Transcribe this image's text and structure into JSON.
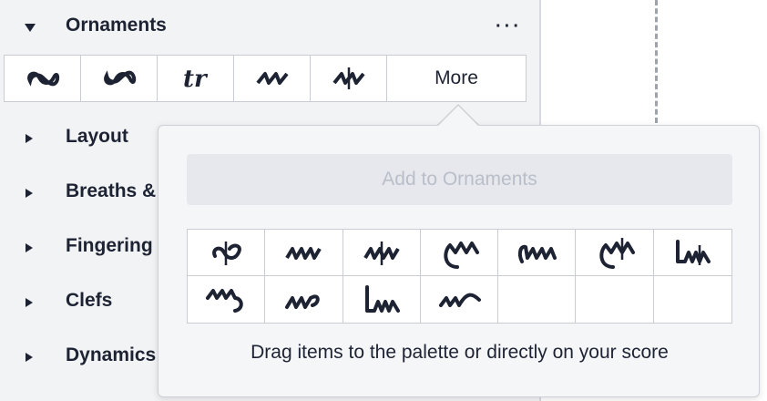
{
  "panel": {
    "sections": [
      {
        "title": "Ornaments",
        "expanded": true
      },
      {
        "title": "Layout",
        "expanded": false
      },
      {
        "title": "Breaths &",
        "expanded": false
      },
      {
        "title": "Fingering",
        "expanded": false
      },
      {
        "title": "Clefs",
        "expanded": false
      },
      {
        "title": "Dynamics",
        "expanded": false
      }
    ],
    "menu_icon": "more-options-icon",
    "ornament_palette": {
      "items": [
        {
          "icon": "turn-icon"
        },
        {
          "icon": "inverted-turn-icon"
        },
        {
          "icon": "trill-icon"
        },
        {
          "icon": "short-trill-icon"
        },
        {
          "icon": "mordent-icon"
        }
      ],
      "more_label": "More"
    }
  },
  "popup": {
    "add_button_label": "Add to Ornaments",
    "hint": "Drag items to the palette or directly on your score",
    "grid_items": [
      {
        "icon": "turn-slash-icon"
      },
      {
        "icon": "tremblement-icon"
      },
      {
        "icon": "pince-icon"
      },
      {
        "icon": "prall-up-icon"
      },
      {
        "icon": "upprall-icon"
      },
      {
        "icon": "prall-mordent-up-icon"
      },
      {
        "icon": "line-prall-icon"
      },
      {
        "icon": "prall-down-icon"
      },
      {
        "icon": "shake-icon"
      },
      {
        "icon": "line-prall-down-icon"
      },
      {
        "icon": "schleifer-icon"
      },
      {
        "icon": "empty"
      },
      {
        "icon": "empty"
      },
      {
        "icon": "empty"
      }
    ]
  },
  "colors": {
    "panel_bg": "#f2f3f5",
    "text": "#1d2333",
    "disabled_text": "#b9bec8"
  }
}
